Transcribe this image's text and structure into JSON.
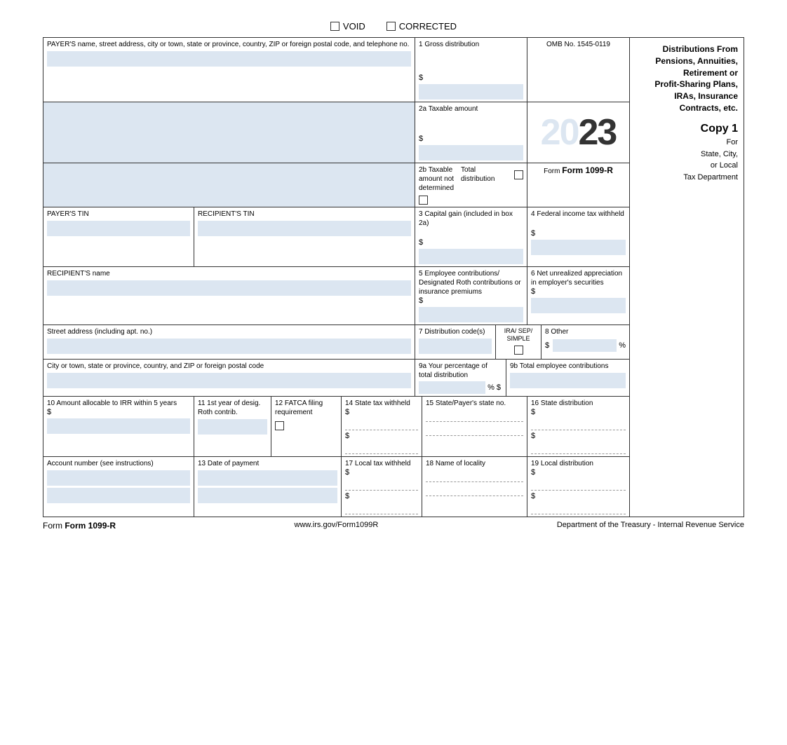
{
  "form": {
    "void_label": "VOID",
    "corrected_label": "CORRECTED",
    "omb_label": "OMB No. 1545-0119",
    "year_prefix": "20",
    "year_suffix": "23",
    "form_name": "Form 1099-R",
    "title_line1": "Distributions From",
    "title_line2": "Pensions, Annuities,",
    "title_line3": "Retirement or",
    "title_line4": "Profit-Sharing Plans,",
    "title_line5": "IRAs, Insurance",
    "title_line6": "Contracts, etc.",
    "copy_label": "Copy 1",
    "copy_for": "For",
    "copy_sub1": "State, City,",
    "copy_sub2": "or Local",
    "copy_sub3": "Tax Department",
    "payer_label": "PAYER'S name, street address, city or town, state or province, country, ZIP or foreign postal code, and telephone no.",
    "box1_label": "1  Gross distribution",
    "box1_dollar": "$",
    "box2a_label": "2a  Taxable amount",
    "box2a_dollar": "$",
    "box2b_label": "2b  Taxable amount not determined",
    "total_distribution_label": "Total distribution",
    "box3_label": "3  Capital gain (included in box 2a)",
    "box3_dollar": "$",
    "box4_label": "4  Federal income tax withheld",
    "box4_dollar": "$",
    "payer_tin_label": "PAYER'S TIN",
    "recipient_tin_label": "RECIPIENT'S TIN",
    "recipient_name_label": "RECIPIENT'S name",
    "box5_label": "5  Employee contributions/ Designated Roth contributions or insurance premiums",
    "box5_dollar": "$",
    "box6_label": "6  Net unrealized appreciation in employer's securities",
    "box6_dollar": "$",
    "street_label": "Street address (including apt. no.)",
    "box7_label": "7  Distribution code(s)",
    "box7_ira_label": "IRA/ SEP/ SIMPLE",
    "box8_label": "8  Other",
    "box8_dollar": "$",
    "box8_percent": "%",
    "city_label": "City or town, state or province, country, and ZIP or foreign postal code",
    "box9a_label": "9a  Your percentage of total distribution",
    "box9a_percent": "%",
    "box9a_dollar": "$",
    "box9b_label": "9b  Total employee contributions",
    "box9b_dollar": "$",
    "box10_label": "10  Amount allocable to IRR within 5 years",
    "box10_dollar": "$",
    "box11_label": "11  1st year of desig. Roth contrib.",
    "box12_label": "12  FATCA filing requirement",
    "box14_label": "14  State tax withheld",
    "box14_dollar1": "$",
    "box14_dollar2": "$",
    "box15_label": "15  State/Payer's state no.",
    "box16_label": "16  State distribution",
    "box16_dollar1": "$",
    "box16_dollar2": "$",
    "account_label": "Account number (see instructions)",
    "box13_label": "13  Date of payment",
    "box17_label": "17  Local tax withheld",
    "box17_dollar1": "$",
    "box17_dollar2": "$",
    "box18_label": "18  Name of locality",
    "box19_label": "19  Local distribution",
    "box19_dollar1": "$",
    "box19_dollar2": "$",
    "footer_form": "Form 1099-R",
    "footer_url": "www.irs.gov/Form1099R",
    "footer_dept": "Department of the Treasury - Internal Revenue Service"
  }
}
